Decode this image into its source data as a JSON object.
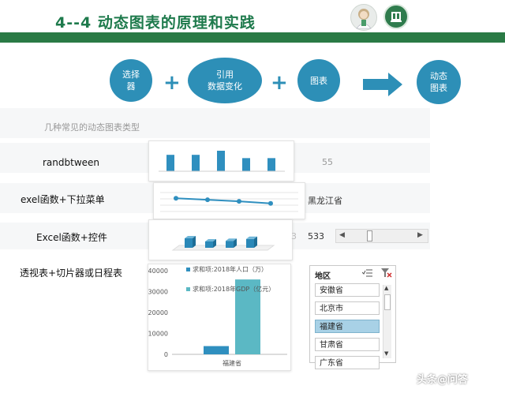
{
  "title": "4--4   动态图表的原理和实践",
  "flow": {
    "step1": "选择\n器",
    "step2": "引用\n数据变化",
    "step3": "图表",
    "step4": "动态\n图表",
    "plus": "+"
  },
  "section_heading": "几种常见的动态图表类型",
  "rows": [
    {
      "label": "randbtween",
      "value": "55"
    },
    {
      "label": "exel函数+下拉菜单",
      "value": "黑龙江省"
    },
    {
      "label": "Excel函数+控件",
      "value": "533",
      "value_prefix": "3"
    },
    {
      "label": "透视表+切片器或日程表"
    }
  ],
  "scrollbar": {
    "left_arrow": "◀",
    "right_arrow": "▶",
    "position": 0.3
  },
  "pivot_chart": {
    "legend": [
      "求和项:2018年人口（万）",
      "求和项:2018年GDP（亿元）"
    ],
    "yticks": [
      "40000",
      "30000",
      "20000",
      "10000",
      "0"
    ],
    "category": "福建省"
  },
  "slicer": {
    "title": "地区",
    "items": [
      "安徽省",
      "北京市",
      "福建省",
      "甘肃省",
      "广东省"
    ],
    "selected": "福建省"
  },
  "watermark": "头条@问答",
  "colors": {
    "brand_green": "#2a7a45",
    "flow_blue": "#2d8fb7",
    "bar_blue": "#2f8fbf",
    "teal": "#5bb8c4"
  },
  "chart_data": [
    {
      "type": "bar",
      "categories": [
        "",
        "",
        "",
        "",
        ""
      ],
      "values": [
        4,
        4,
        5,
        3.2,
        3.2
      ]
    },
    {
      "type": "line",
      "categories": [
        "",
        "",
        "",
        ""
      ],
      "values": [
        3.2,
        2.9,
        2.6,
        2.2
      ]
    },
    {
      "type": "bar",
      "categories": [
        "福建省"
      ],
      "series": [
        {
          "name": "求和项:2018年人口（万）",
          "values": [
            3941
          ]
        },
        {
          "name": "求和项:2018年GDP（亿元）",
          "values": [
            35804
          ]
        }
      ],
      "ylim": [
        0,
        40000
      ]
    }
  ]
}
